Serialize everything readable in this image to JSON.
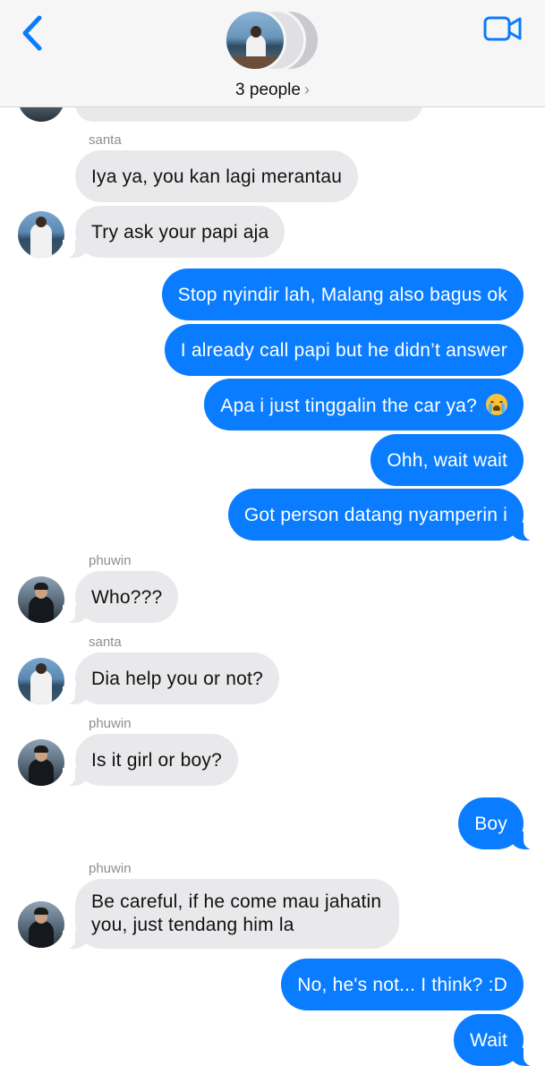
{
  "header": {
    "group_label": "3 people",
    "icons": {
      "back": "chevron-left-icon",
      "video": "video-camera-icon",
      "chevron": "chevron-right-icon"
    }
  },
  "colors": {
    "accent": "#0a7cff",
    "incoming": "#e9e9eb",
    "header_bg": "#f6f6f6"
  },
  "messages": [
    {
      "from": "",
      "direction": "in",
      "text": "",
      "partial": true
    },
    {
      "sender_label": "santa"
    },
    {
      "from": "santa",
      "direction": "in",
      "text": "Iya ya, you kan lagi merantau"
    },
    {
      "from": "santa",
      "direction": "in",
      "text": "Try ask your papi aja"
    },
    {
      "direction": "out",
      "text": "Stop nyindir lah, Malang also bagus ok"
    },
    {
      "direction": "out",
      "text": "I already call papi but he didn’t answer"
    },
    {
      "direction": "out",
      "text": "Apa i just tinggalin the car ya?",
      "emoji": "loudly-crying-face"
    },
    {
      "direction": "out",
      "text": "Ohh, wait wait"
    },
    {
      "direction": "out",
      "text": "Got person datang nyamperin i"
    },
    {
      "sender_label": "phuwin"
    },
    {
      "from": "phuwin",
      "direction": "in",
      "text": "Who???"
    },
    {
      "sender_label": "santa"
    },
    {
      "from": "santa",
      "direction": "in",
      "text": "Dia help you or not?"
    },
    {
      "sender_label": "phuwin"
    },
    {
      "from": "phuwin",
      "direction": "in",
      "text": "Is it girl or boy?"
    },
    {
      "direction": "out",
      "text": "Boy"
    },
    {
      "sender_label": "phuwin"
    },
    {
      "from": "phuwin",
      "direction": "in",
      "text": "Be careful, if he come mau jahatin you, just tendang him la"
    },
    {
      "direction": "out",
      "text": "No, he's not... I think? :D"
    },
    {
      "direction": "out",
      "text": "Wait"
    }
  ],
  "senders": {
    "santa": "santa",
    "phuwin": "phuwin"
  }
}
